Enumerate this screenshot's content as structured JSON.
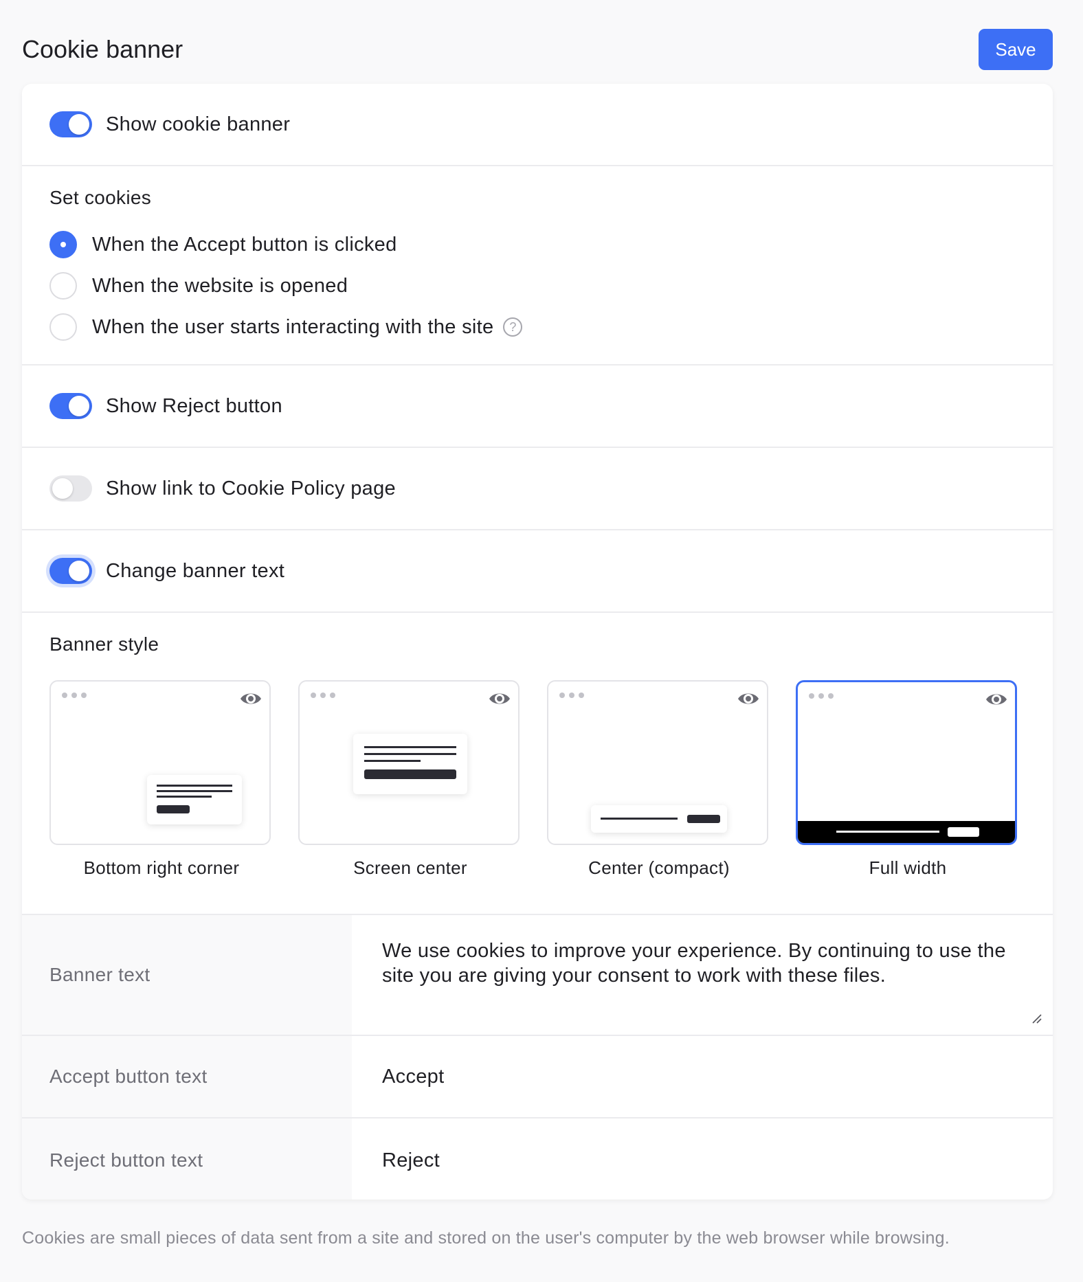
{
  "header": {
    "title": "Cookie banner",
    "save_label": "Save"
  },
  "toggles": {
    "show_banner": {
      "label": "Show cookie banner",
      "on": true
    },
    "show_reject": {
      "label": "Show Reject button",
      "on": true
    },
    "show_policy_link": {
      "label": "Show link to Cookie Policy page",
      "on": false
    },
    "change_text": {
      "label": "Change banner text",
      "on": true
    }
  },
  "set_cookies": {
    "title": "Set cookies",
    "options": [
      {
        "label": "When the Accept button is clicked",
        "checked": true
      },
      {
        "label": "When the website is opened",
        "checked": false
      },
      {
        "label": "When the user starts interacting with the site",
        "checked": false
      }
    ],
    "help_glyph": "?"
  },
  "banner_style": {
    "title": "Banner style",
    "options": [
      {
        "label": "Bottom right corner",
        "selected": false
      },
      {
        "label": "Screen center",
        "selected": false
      },
      {
        "label": "Center (compact)",
        "selected": false
      },
      {
        "label": "Full width",
        "selected": true
      }
    ]
  },
  "form": {
    "banner_text_label": "Banner text",
    "banner_text_value": "We use cookies to improve your experience. By continuing to use the site you are giving your consent to work with these files.",
    "accept_label": "Accept button text",
    "accept_value": "Accept",
    "reject_label": "Reject button text",
    "reject_value": "Reject"
  },
  "footer": {
    "note": "Cookies are small pieces of data sent from a site and stored on the user's computer by the web browser while browsing."
  },
  "colors": {
    "accent": "#3d6ff5",
    "toggle_off": "#e7e7ea",
    "muted_text": "#6e6e76"
  },
  "icons": {
    "preview": "eye-icon",
    "help": "question-circle-icon",
    "resize": "resize-handle-icon"
  }
}
